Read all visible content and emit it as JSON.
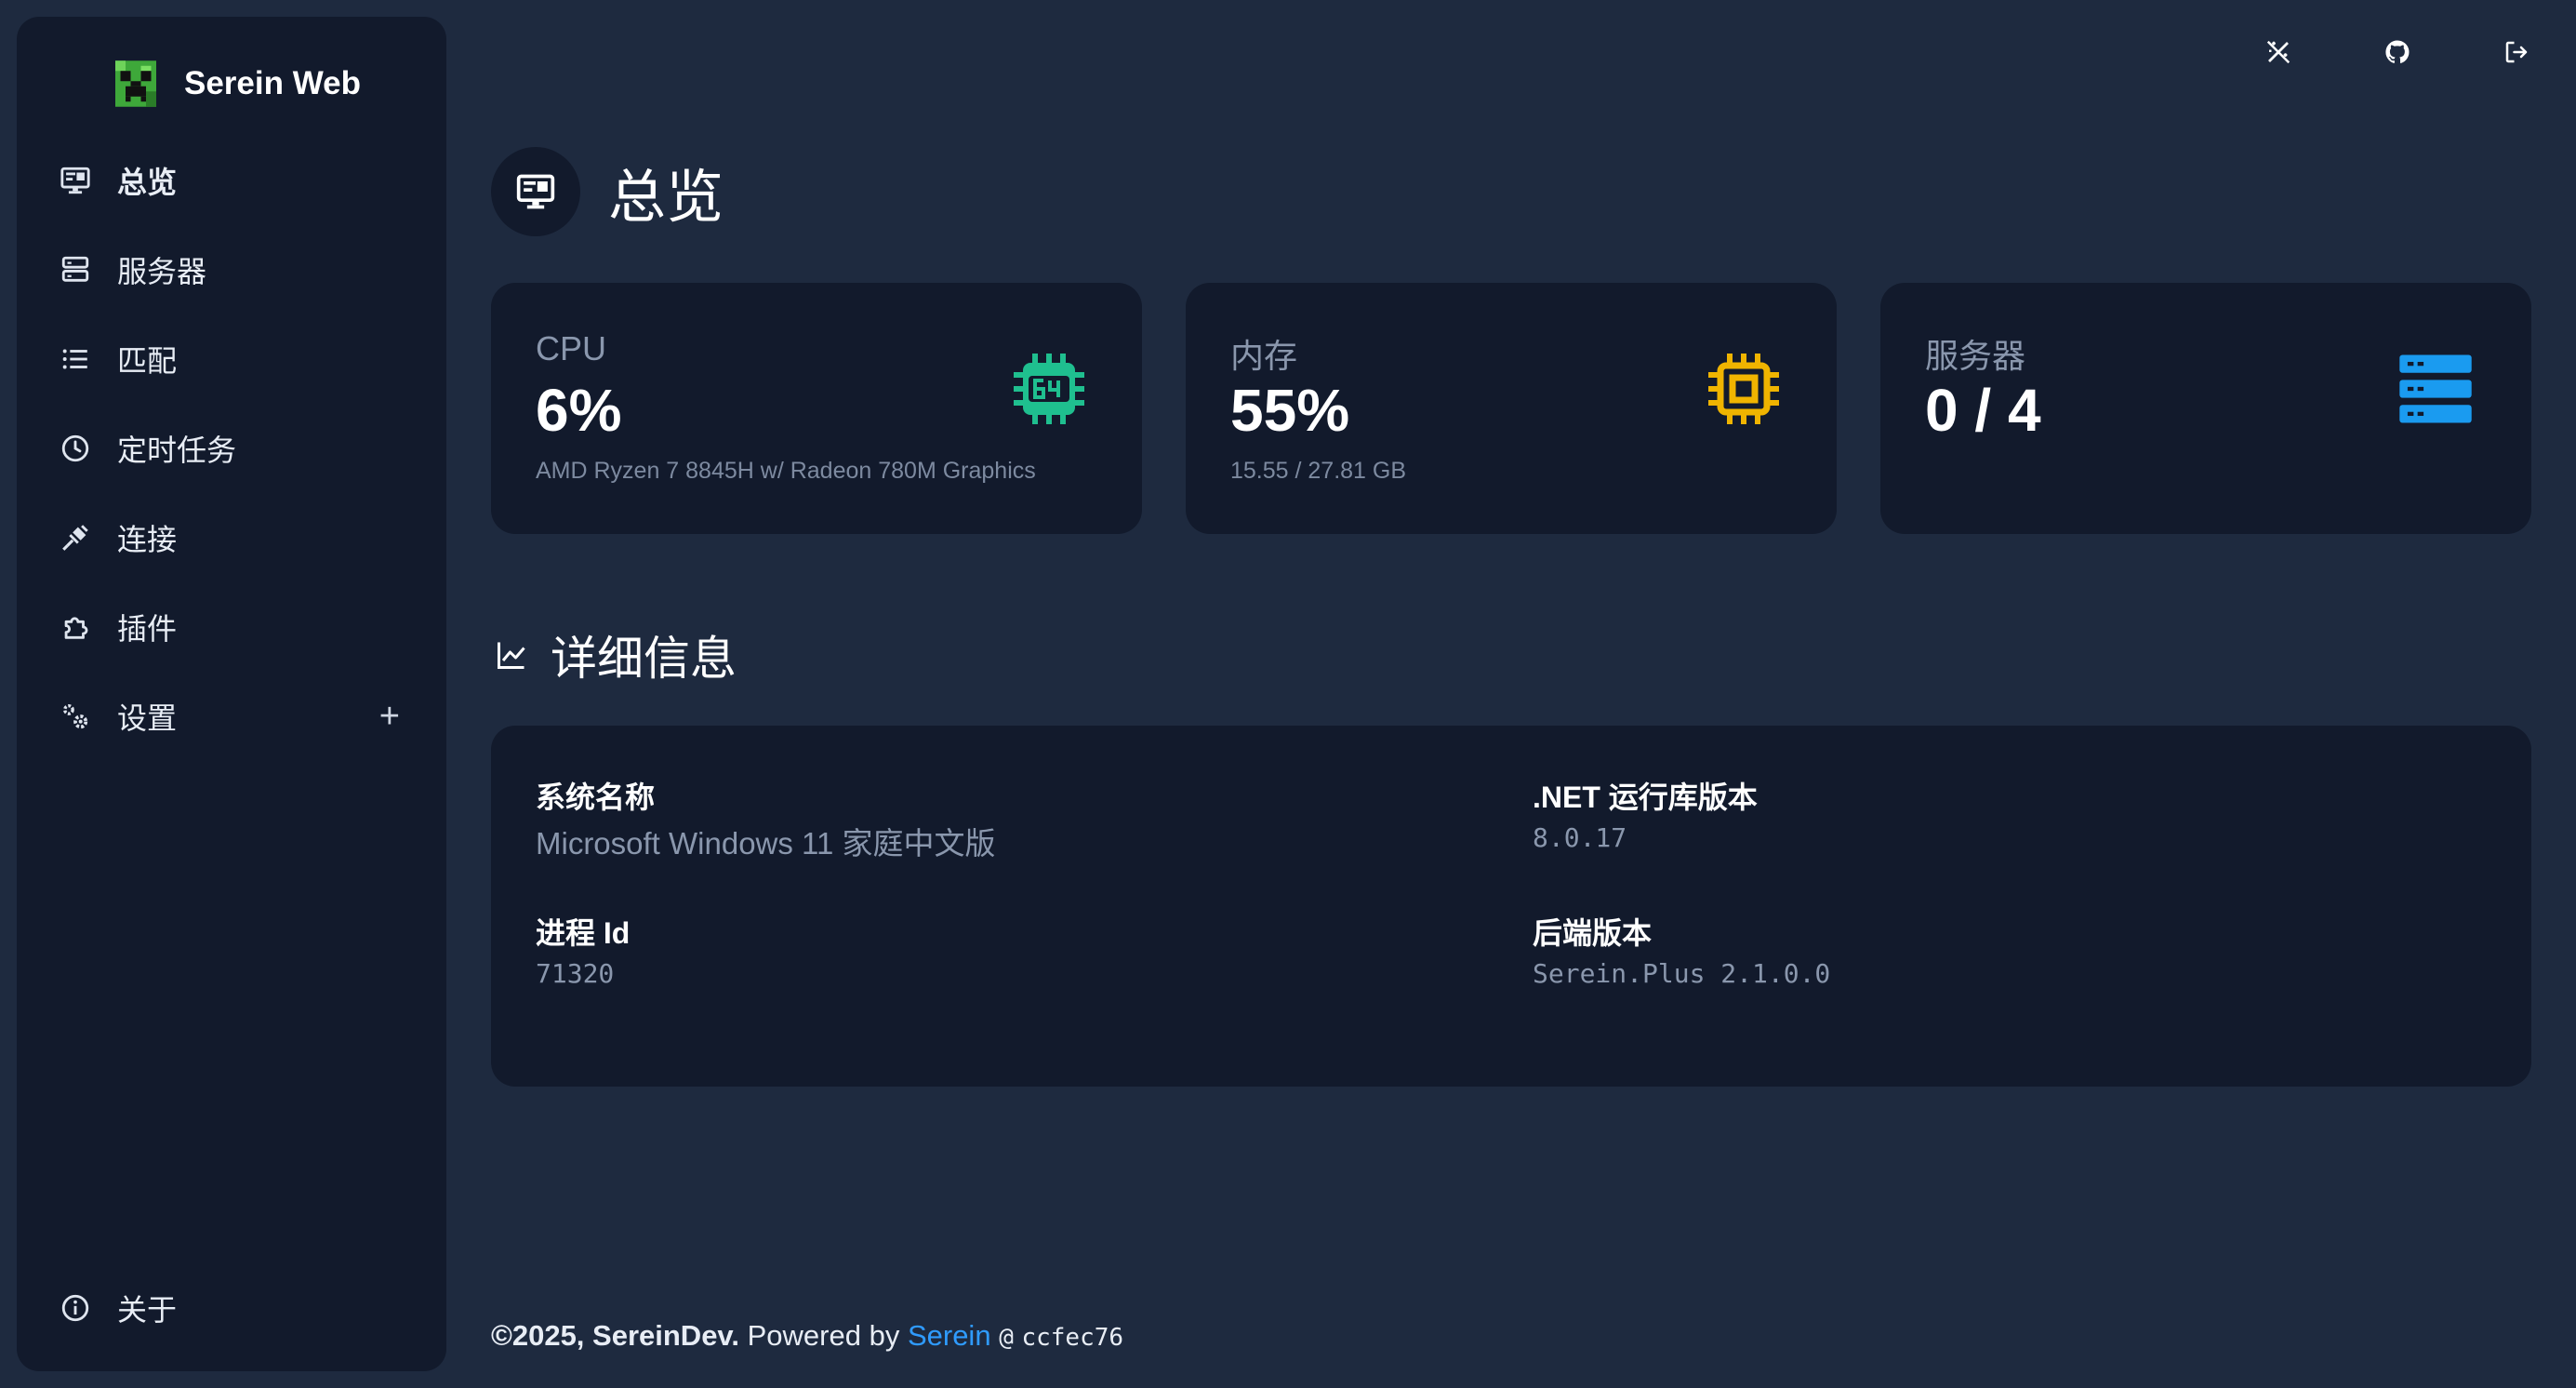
{
  "app": {
    "name": "Serein Web",
    "logo_icon": "creeper-icon"
  },
  "sidebar": {
    "items": [
      {
        "label": "总览",
        "icon": "monitor-icon"
      },
      {
        "label": "服务器",
        "icon": "server-icon"
      },
      {
        "label": "匹配",
        "icon": "list-icon"
      },
      {
        "label": "定时任务",
        "icon": "clock-icon"
      },
      {
        "label": "连接",
        "icon": "plug-icon"
      },
      {
        "label": "插件",
        "icon": "puzzle-icon"
      },
      {
        "label": "设置",
        "icon": "gears-icon",
        "expand": "+"
      }
    ],
    "bottom": {
      "label": "关于",
      "icon": "info-icon"
    }
  },
  "topbar": {
    "icons": [
      "magic-wand-icon",
      "github-icon",
      "logout-icon"
    ]
  },
  "page": {
    "title": "总览"
  },
  "cards": [
    {
      "label": "CPU",
      "value": "6%",
      "sub": "AMD Ryzen 7 8845H w/ Radeon 780M Graphics",
      "icon": "cpu-64-icon",
      "color": "#1fbf8f"
    },
    {
      "label": "内存",
      "value": "55%",
      "sub": "15.55 / 27.81 GB",
      "icon": "chip-icon",
      "color": "#f0b400"
    },
    {
      "label": "服务器",
      "value": "0 / 4",
      "sub": "",
      "icon": "server-stack-icon",
      "color": "#1a9bf0"
    }
  ],
  "details": {
    "title": "详细信息",
    "items": [
      {
        "key": "系统名称",
        "value": "Microsoft Windows 11 家庭中文版"
      },
      {
        "key": ".NET 运行库版本",
        "value": "8.0.17"
      },
      {
        "key": "进程 Id",
        "value": "71320"
      },
      {
        "key": "后端版本",
        "value": "Serein.Plus 2.1.0.0"
      }
    ]
  },
  "footer": {
    "copyright": "©2025, SereinDev.",
    "powered": "Powered by",
    "link": "Serein",
    "at": "@",
    "commit": "ccfec76"
  },
  "colors": {
    "background": "#1e2a3f",
    "panel": "#121a2c",
    "accent": "#2f9bff"
  }
}
